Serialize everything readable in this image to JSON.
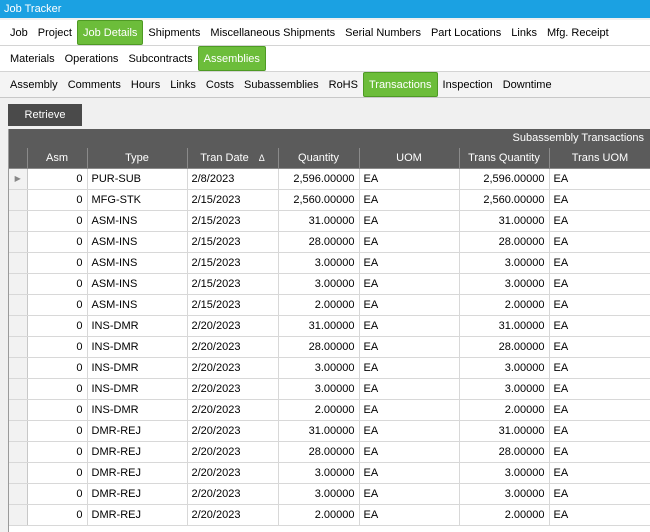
{
  "window": {
    "title": "Job Tracker"
  },
  "tabs_main": [
    {
      "label": "Job",
      "active": false
    },
    {
      "label": "Project",
      "active": false
    },
    {
      "label": "Job Details",
      "active": true
    },
    {
      "label": "Shipments",
      "active": false
    },
    {
      "label": "Miscellaneous Shipments",
      "active": false
    },
    {
      "label": "Serial Numbers",
      "active": false
    },
    {
      "label": "Part Locations",
      "active": false
    },
    {
      "label": "Links",
      "active": false
    },
    {
      "label": "Mfg. Receipt",
      "active": false
    }
  ],
  "tabs_details": [
    {
      "label": "Materials",
      "active": false
    },
    {
      "label": "Operations",
      "active": false
    },
    {
      "label": "Subcontracts",
      "active": false
    },
    {
      "label": "Assemblies",
      "active": true
    }
  ],
  "tabs_assembly": [
    {
      "label": "Assembly",
      "active": false
    },
    {
      "label": "Comments",
      "active": false
    },
    {
      "label": "Hours",
      "active": false
    },
    {
      "label": "Links",
      "active": false
    },
    {
      "label": "Costs",
      "active": false
    },
    {
      "label": "Subassemblies",
      "active": false
    },
    {
      "label": "RoHS",
      "active": false
    },
    {
      "label": "Transactions",
      "active": true
    },
    {
      "label": "Inspection",
      "active": false
    },
    {
      "label": "Downtime",
      "active": false
    }
  ],
  "toolbar": {
    "retrieve_label": "Retrieve"
  },
  "grid": {
    "caption": "Subassembly Transactions",
    "sort_indicator": "Δ",
    "columns": [
      "Asm",
      "Type",
      "Tran Date",
      "Quantity",
      "UOM",
      "Trans Quantity",
      "Trans UOM"
    ],
    "rows": [
      [
        "0",
        "PUR-SUB",
        "2/8/2023",
        "2,596.00000",
        "EA",
        "2,596.00000",
        "EA"
      ],
      [
        "0",
        "MFG-STK",
        "2/15/2023",
        "2,560.00000",
        "EA",
        "2,560.00000",
        "EA"
      ],
      [
        "0",
        "ASM-INS",
        "2/15/2023",
        "31.00000",
        "EA",
        "31.00000",
        "EA"
      ],
      [
        "0",
        "ASM-INS",
        "2/15/2023",
        "28.00000",
        "EA",
        "28.00000",
        "EA"
      ],
      [
        "0",
        "ASM-INS",
        "2/15/2023",
        "3.00000",
        "EA",
        "3.00000",
        "EA"
      ],
      [
        "0",
        "ASM-INS",
        "2/15/2023",
        "3.00000",
        "EA",
        "3.00000",
        "EA"
      ],
      [
        "0",
        "ASM-INS",
        "2/15/2023",
        "2.00000",
        "EA",
        "2.00000",
        "EA"
      ],
      [
        "0",
        "INS-DMR",
        "2/20/2023",
        "31.00000",
        "EA",
        "31.00000",
        "EA"
      ],
      [
        "0",
        "INS-DMR",
        "2/20/2023",
        "28.00000",
        "EA",
        "28.00000",
        "EA"
      ],
      [
        "0",
        "INS-DMR",
        "2/20/2023",
        "3.00000",
        "EA",
        "3.00000",
        "EA"
      ],
      [
        "0",
        "INS-DMR",
        "2/20/2023",
        "3.00000",
        "EA",
        "3.00000",
        "EA"
      ],
      [
        "0",
        "INS-DMR",
        "2/20/2023",
        "2.00000",
        "EA",
        "2.00000",
        "EA"
      ],
      [
        "0",
        "DMR-REJ",
        "2/20/2023",
        "31.00000",
        "EA",
        "31.00000",
        "EA"
      ],
      [
        "0",
        "DMR-REJ",
        "2/20/2023",
        "28.00000",
        "EA",
        "28.00000",
        "EA"
      ],
      [
        "0",
        "DMR-REJ",
        "2/20/2023",
        "3.00000",
        "EA",
        "3.00000",
        "EA"
      ],
      [
        "0",
        "DMR-REJ",
        "2/20/2023",
        "3.00000",
        "EA",
        "3.00000",
        "EA"
      ],
      [
        "0",
        "DMR-REJ",
        "2/20/2023",
        "2.00000",
        "EA",
        "2.00000",
        "EA"
      ]
    ]
  }
}
